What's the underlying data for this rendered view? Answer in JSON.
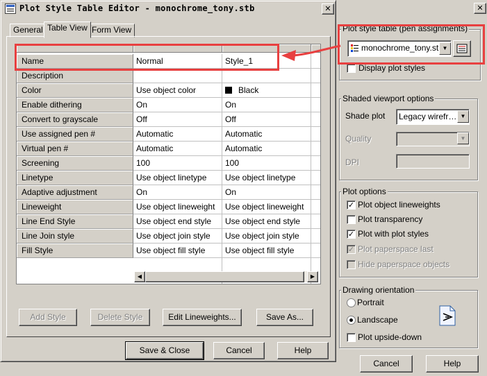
{
  "plot_dialog": {
    "pen_group_label": "Plot style table (pen assignments)",
    "pen_table_value": "monochrome_tony.stb",
    "display_plot_styles": "Display plot styles",
    "shaded_group_label": "Shaded viewport options",
    "shade_plot_label": "Shade plot",
    "shade_plot_value": "Legacy wirefr…",
    "quality_label": "Quality",
    "dpi_label": "DPI",
    "plot_options_label": "Plot options",
    "opt_lineweights": "Plot object lineweights",
    "opt_transparency": "Plot transparency",
    "opt_plot_styles": "Plot with plot styles",
    "opt_paperspace_last": "Plot paperspace last",
    "opt_hide_paperspace": "Hide paperspace objects",
    "orientation_label": "Drawing orientation",
    "portrait": "Portrait",
    "landscape": "Landscape",
    "upside_down": "Plot upside-down",
    "cancel": "Cancel",
    "help": "Help"
  },
  "editor": {
    "title": "Plot Style Table Editor - monochrome_tony.stb",
    "tabs": [
      "General",
      "Table View",
      "Form View"
    ],
    "rows": [
      [
        "Name",
        "Normal",
        "Style_1"
      ],
      [
        "Description",
        "",
        ""
      ],
      [
        "Color",
        "Use object color",
        "Black"
      ],
      [
        "Enable dithering",
        "On",
        "On"
      ],
      [
        "Convert to grayscale",
        "Off",
        "Off"
      ],
      [
        "Use assigned pen #",
        "Automatic",
        "Automatic"
      ],
      [
        "Virtual pen #",
        "Automatic",
        "Automatic"
      ],
      [
        "Screening",
        "100",
        "100"
      ],
      [
        "Linetype",
        "Use object linetype",
        "Use object linetype"
      ],
      [
        "Adaptive adjustment",
        "On",
        "On"
      ],
      [
        "Lineweight",
        "Use object lineweight",
        "Use object lineweight"
      ],
      [
        "Line End Style",
        "Use object end style",
        "Use object end style"
      ],
      [
        "Line Join style",
        "Use object join style",
        "Use object join style"
      ],
      [
        "Fill Style",
        "Use object fill style",
        "Use object fill style"
      ]
    ],
    "add_style": "Add Style",
    "delete_style": "Delete Style",
    "edit_lineweights": "Edit Lineweights...",
    "save_as": "Save As...",
    "save_close": "Save & Close",
    "cancel": "Cancel",
    "help": "Help"
  },
  "colors": {
    "highlight": "#e84040",
    "swatch_black": "#000000"
  }
}
